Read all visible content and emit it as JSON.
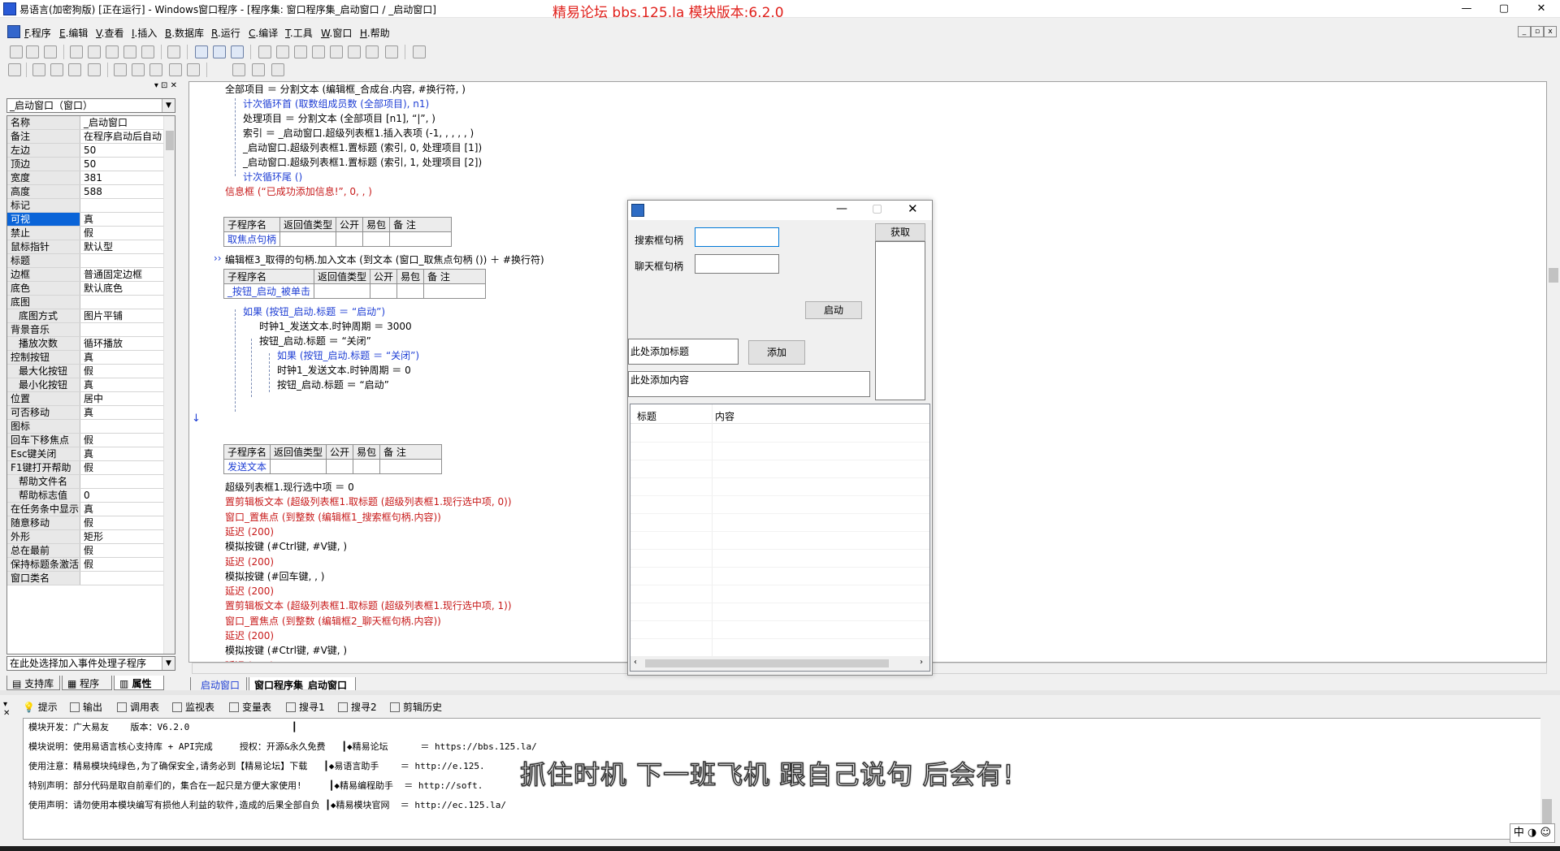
{
  "window": {
    "title": "易语言(加密狗版) [正在运行] - Windows窗口程序 - [程序集: 窗口程序集_启动窗口 / _启动窗口]",
    "banner": "精易论坛 bbs.125.la 模块版本:6.2.0",
    "min": "—",
    "max": "▢",
    "close": "✕"
  },
  "menu": [
    {
      "key": "F",
      "label": ".程序"
    },
    {
      "key": "E",
      "label": ".编辑"
    },
    {
      "key": "V",
      "label": ".查看"
    },
    {
      "key": "I",
      "label": ".插入"
    },
    {
      "key": "B",
      "label": ".数据库"
    },
    {
      "key": "R",
      "label": ".运行"
    },
    {
      "key": "C",
      "label": ".编译"
    },
    {
      "key": "T",
      "label": ".工具"
    },
    {
      "key": "W",
      "label": ".窗口"
    },
    {
      "key": "H",
      "label": ".帮助"
    }
  ],
  "left": {
    "panel_btns": "▾ ⊡ ✕",
    "object_combo": "_启动窗口（窗口）",
    "event_combo": "在此处选择加入事件处理子程序",
    "props": [
      {
        "n": "名称",
        "v": "_启动窗口"
      },
      {
        "n": "备注",
        "v": "在程序启动后自动"
      },
      {
        "n": "左边",
        "v": "50"
      },
      {
        "n": "顶边",
        "v": "50"
      },
      {
        "n": "宽度",
        "v": "381"
      },
      {
        "n": "高度",
        "v": "588"
      },
      {
        "n": "标记",
        "v": ""
      },
      {
        "n": "可视",
        "v": "真"
      },
      {
        "n": "禁止",
        "v": "假"
      },
      {
        "n": "鼠标指针",
        "v": "默认型"
      },
      {
        "n": "标题",
        "v": ""
      },
      {
        "n": "边框",
        "v": "普通固定边框"
      },
      {
        "n": "底色",
        "v": "默认底色"
      },
      {
        "n": "底图",
        "v": ""
      },
      {
        "n": "底图方式",
        "v": "图片平铺"
      },
      {
        "n": "背景音乐",
        "v": ""
      },
      {
        "n": "播放次数",
        "v": "循环播放"
      },
      {
        "n": "控制按钮",
        "v": "真"
      },
      {
        "n": "最大化按钮",
        "v": "假"
      },
      {
        "n": "最小化按钮",
        "v": "真"
      },
      {
        "n": "位置",
        "v": "居中"
      },
      {
        "n": "可否移动",
        "v": "真"
      },
      {
        "n": "图标",
        "v": ""
      },
      {
        "n": "回车下移焦点",
        "v": "假"
      },
      {
        "n": "Esc键关闭",
        "v": "真"
      },
      {
        "n": "F1键打开帮助",
        "v": "假"
      },
      {
        "n": "帮助文件名",
        "v": ""
      },
      {
        "n": "帮助标志值",
        "v": "0"
      },
      {
        "n": "在任务条中显示",
        "v": "真"
      },
      {
        "n": "随意移动",
        "v": "假"
      },
      {
        "n": "外形",
        "v": "矩形"
      },
      {
        "n": "总在最前",
        "v": "假"
      },
      {
        "n": "保持标题条激活",
        "v": "假"
      },
      {
        "n": "窗口类名",
        "v": ""
      }
    ],
    "tabs": [
      "支持库",
      "程序",
      "属性"
    ]
  },
  "code": {
    "lines_top": [
      "全部项目 ＝ 分割文本 (编辑框_合成台.内容, #换行符, )",
      "计次循环首 (取数组成员数 (全部项目), n1)",
      "处理项目 ＝ 分割文本 (全部项目 [n1], “|”, )",
      "索引 ＝ _启动窗口.超级列表框1.插入表项 (-1, , , , , )",
      "_启动窗口.超级列表框1.置标题 (索引, 0, 处理项目 [1])",
      "_启动窗口.超级列表框1.置标题 (索引, 1, 处理项目 [2])",
      "计次循环尾 ()",
      "信息框 (“已成功添加信息!”, 0, , )"
    ],
    "sub_headers": [
      "子程序名",
      "返回值类型",
      "公开",
      "易包",
      "备 注"
    ],
    "sub1_name": "取焦点句柄",
    "line_sub1": "编辑框3_取得的句柄.加入文本 (到文本 (窗口_取焦点句柄 ()) ＋ #换行符)",
    "sub2_name": "_按钮_启动_被单击",
    "lines_mid": [
      "如果 (按钮_启动.标题 ＝ “启动”)",
      "时钟1_发送文本.时钟周期 ＝ 3000",
      "按钮_启动.标题 ＝ “关闭”",
      "如果 (按钮_启动.标题 ＝ “关闭”)",
      "时钟1_发送文本.时钟周期 ＝ 0",
      "按钮_启动.标题 ＝ “启动”"
    ],
    "sub3_name": "发送文本",
    "lines_bottom": [
      "超级列表框1.现行选中项 ＝ 0",
      "置剪辑板文本 (超级列表框1.取标题 (超级列表框1.现行选中项, 0))",
      "窗口_置焦点 (到整数 (编辑框1_搜索框句柄.内容))",
      "延迟 (200)",
      "模拟按键 (#Ctrl键, #V键, )",
      "延迟 (200)",
      "模拟按键 (#回车键, , )",
      "延迟 (200)",
      "置剪辑板文本 (超级列表框1.取标题 (超级列表框1.现行选中项, 1))",
      "窗口_置焦点 (到整数 (编辑框2_聊天框句柄.内容))",
      "延迟 (200)",
      "模拟按键 (#Ctrl键, #V键, )",
      "延迟 (200)"
    ],
    "tabs": [
      "_启动窗口",
      "窗口程序集_启动窗口"
    ]
  },
  "form": {
    "label_search": "搜索框句柄",
    "label_chat": "聊天框句柄",
    "btn_get": "获取",
    "btn_start": "启动",
    "btn_add": "添加",
    "title_input": "此处添加标题",
    "content_input": "此处添加内容",
    "col_title": "标题",
    "col_content": "内容"
  },
  "output": {
    "tabs": [
      "提示",
      "输出",
      "调用表",
      "监视表",
      "变量表",
      "搜寻1",
      "搜寻2",
      "剪辑历史"
    ],
    "lines": [
      "模块开发：广大易友    版本：V6.2.0                   ┃",
      "模块说明：使用易语言核心支持库 + API完成     授权：开源&永久免费   ┃◆精易论坛      ＝ https://bbs.125.la/",
      "使用注意：精易模块纯绿色,为了确保安全,请务必到【精易论坛】下载   ┃◆易语言助手    ＝ http://e.125.",
      "特别声明：部分代码是取自前辈们的，集合在一起只是方便大家使用!     ┃◆精易编程助手  ＝ http://soft.",
      "使用声明：请勿使用本模块编写有损他人利益的软件,造成的后果全部自负 ┃◆精易模块官网  ＝ http://ec.125.la/"
    ]
  },
  "overlay_caption": "抓住时机 下一班飞机 跟自己说句 后会有!",
  "ime": "中 ◑ ☺"
}
